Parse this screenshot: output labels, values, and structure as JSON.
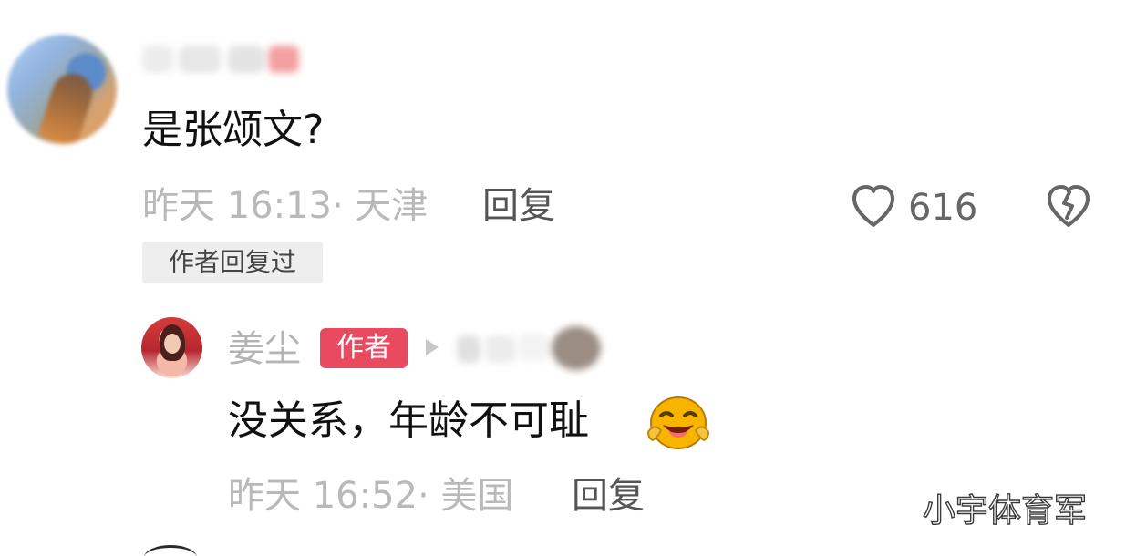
{
  "comment": {
    "text": "是张颂文?",
    "meta": "昨天 16:13· 天津",
    "reply_label": "回复",
    "like_count": "616",
    "author_replied_badge": "作者回复过"
  },
  "reply": {
    "author_name": "姜尘",
    "author_tag": "作者",
    "text": "没关系，年龄不可耻",
    "meta": "昨天 16:52· 美国",
    "reply_label": "回复"
  },
  "watermark": "小宇体育军",
  "icons": {
    "like": "heart-icon",
    "dislike": "broken-heart-icon",
    "reply_pointer": "triangle-right-icon",
    "emoji": "laughing-face-emoji"
  },
  "colors": {
    "author_tag": "#ea4a5f",
    "meta_text": "#b9b9b9",
    "main_text": "#111111"
  }
}
